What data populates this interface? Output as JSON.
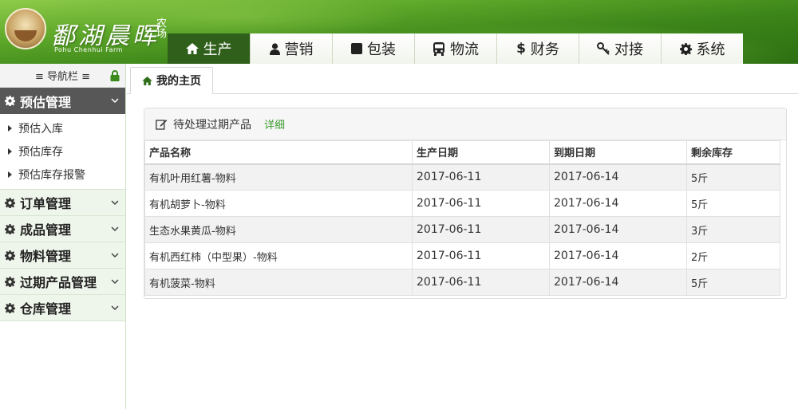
{
  "header": {
    "logo_title": "鄱湖晨晖",
    "logo_side": "农场",
    "logo_sub": "Pohu Chenhui Farm"
  },
  "topnav": [
    {
      "label": "生产",
      "icon": "home-icon",
      "active": true
    },
    {
      "label": "营销",
      "icon": "user-icon",
      "active": false
    },
    {
      "label": "包装",
      "icon": "square-icon",
      "active": false
    },
    {
      "label": "物流",
      "icon": "bus-icon",
      "active": false
    },
    {
      "label": "财务",
      "icon": "dollar-icon",
      "active": false
    },
    {
      "label": "对接",
      "icon": "key-icon",
      "active": false
    },
    {
      "label": "系统",
      "icon": "gear-icon",
      "active": false
    }
  ],
  "sidebar": {
    "title": "≡ 导航栏 ≡",
    "groups": [
      {
        "label": "预估管理",
        "active": true,
        "items": [
          "预估入库",
          "预估库存",
          "预估库存报警"
        ]
      },
      {
        "label": "订单管理"
      },
      {
        "label": "成品管理"
      },
      {
        "label": "物料管理"
      },
      {
        "label": "过期产品管理"
      },
      {
        "label": "仓库管理"
      }
    ]
  },
  "main": {
    "tab_label": "我的主页",
    "panel": {
      "title": "待处理过期产品",
      "detail_link": "详细",
      "columns": [
        "产品名称",
        "生产日期",
        "到期日期",
        "剩余库存"
      ],
      "rows": [
        [
          "有机叶用红薯-物料",
          "2017-06-11",
          "2017-06-14",
          "5斤"
        ],
        [
          "有机胡萝卜-物料",
          "2017-06-11",
          "2017-06-14",
          "5斤"
        ],
        [
          "生态水果黄瓜-物料",
          "2017-06-11",
          "2017-06-14",
          "3斤"
        ],
        [
          "有机西红柿（中型果）-物料",
          "2017-06-11",
          "2017-06-14",
          "2斤"
        ],
        [
          "有机菠菜-物料",
          "2017-06-11",
          "2017-06-14",
          "5斤"
        ]
      ]
    }
  },
  "colors": {
    "nav_active": "#2f5f1a",
    "sidebar_active": "#575757",
    "link_green": "#3a9a2c"
  }
}
